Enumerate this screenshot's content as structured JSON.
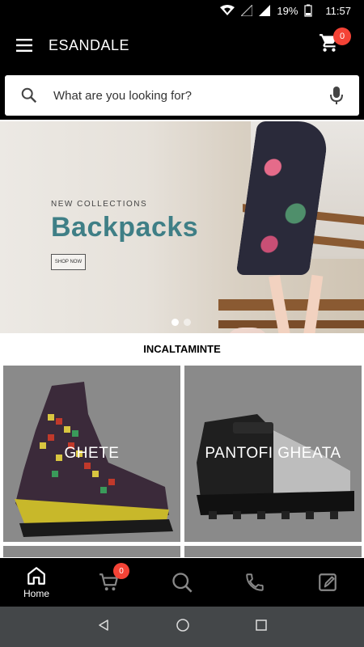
{
  "status_bar": {
    "battery": "19%",
    "time": "11:57"
  },
  "app_bar": {
    "title": "ESANDALE",
    "cart_count": "0"
  },
  "search": {
    "placeholder": "What are you looking for?"
  },
  "banner": {
    "subtitle": "NEW COLLECTIONS",
    "title": "Backpacks",
    "button_label": "SHOP NOW",
    "slide_count": 2,
    "active_slide": 1
  },
  "section": {
    "title": "INCALTAMINTE"
  },
  "categories": [
    {
      "label": "GHETE"
    },
    {
      "label": "PANTOFI GHEATA"
    }
  ],
  "bottom_nav": {
    "home_label": "Home",
    "cart_count": "0",
    "items": [
      "home-icon",
      "cart-icon",
      "search-icon",
      "phone-icon",
      "edit-icon"
    ]
  },
  "colors": {
    "bar_background": "#000000",
    "badge": "#f44336",
    "banner_title": "#3f7f86",
    "system_nav": "#444749"
  }
}
